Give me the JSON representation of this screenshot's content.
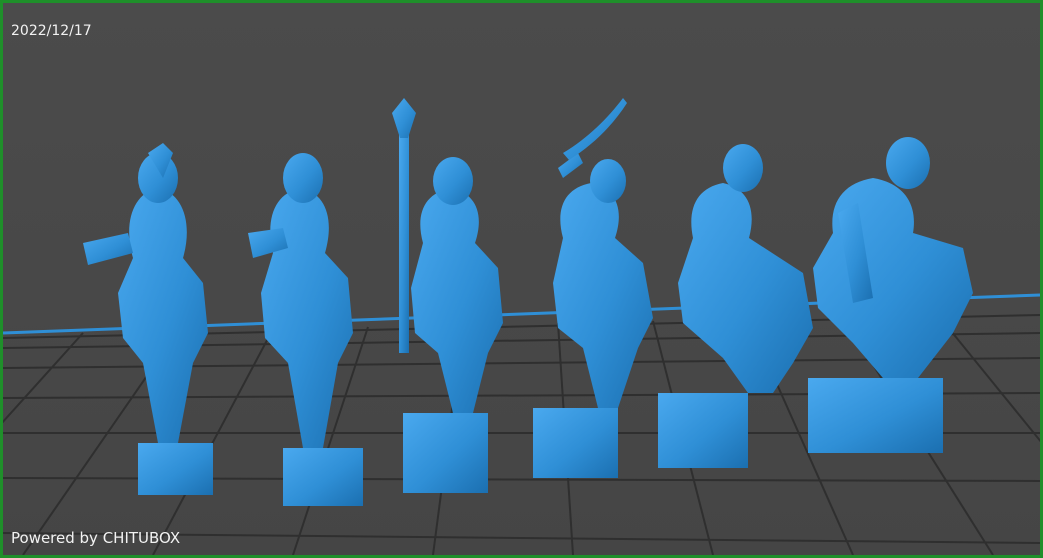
{
  "viewport": {
    "date_label": "2022/12/17",
    "watermark": "Powered by CHITUBOX"
  },
  "scene": {
    "model_color": "#2f8fd6",
    "plate_edge_color": "#2f8fd6",
    "border_color": "#1f8f2a",
    "background_color": "#4a4a4a",
    "miniature_count": 6
  }
}
